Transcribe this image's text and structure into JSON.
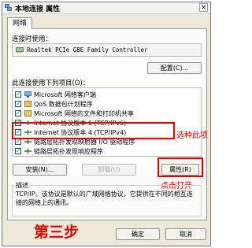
{
  "window": {
    "title": "本地连接 属性",
    "close_label": "×"
  },
  "tabs": [
    {
      "label": "网络"
    }
  ],
  "connect_using_label": "连接时使用：",
  "adapter_name": "Realtek PCIe GBE Family Controller",
  "configure_button": "配置(C)...",
  "components_label": "此连接使用下列项目(O)：",
  "components": [
    {
      "label": "Microsoft 网络客户端",
      "checked": true
    },
    {
      "label": "QoS 数据包计划程序",
      "checked": true
    },
    {
      "label": "Microsoft 网络的文件和打印机共享",
      "checked": true
    },
    {
      "label": "Internet 协议版本 6 (TCP/IPv6)",
      "checked": true
    },
    {
      "label": "Internet 协议版本 4 (TCP/IPv4)",
      "checked": true
    },
    {
      "label": "链路层拓扑发现映射器 I/O 驱动程序",
      "checked": true
    },
    {
      "label": "链路层拓扑发现响应程序",
      "checked": true
    }
  ],
  "buttons": {
    "install": "安装(N)...",
    "uninstall": "卸载(U)",
    "properties": "属性(R)",
    "ok": "确定",
    "cancel": "取消"
  },
  "description": {
    "title": "描述",
    "text": "TCP/IP。该协议是默认的广域网络协议，它提供在不同的相互连接的网络上的通讯。"
  },
  "annotations": {
    "select_item": "选种此项",
    "click_open": "点击打开",
    "step": "第三步"
  },
  "colors": {
    "annotation_red": "#e00000",
    "window_bg": "#ece9d8"
  }
}
